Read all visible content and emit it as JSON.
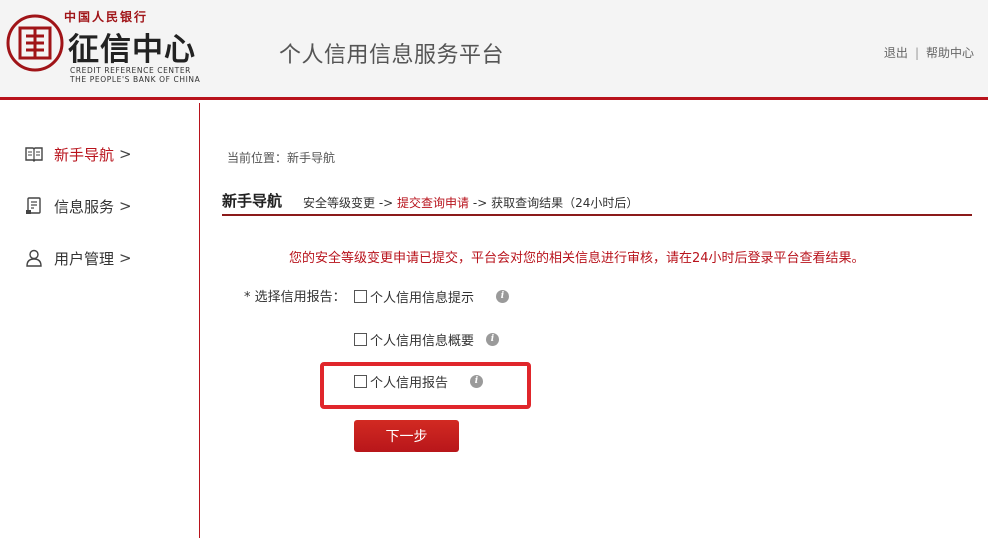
{
  "header": {
    "logo_top": "中国人民银行",
    "logo_name": "征信中心",
    "logo_en_line1": "CREDIT REFERENCE CENTER",
    "logo_en_line2": "THE PEOPLE'S BANK OF CHINA",
    "platform_title": "个人信用信息服务平台",
    "logout": "退出",
    "separator": "|",
    "help": "帮助中心"
  },
  "sidebar": {
    "items": [
      {
        "label": "新手导航",
        "arrow": ">",
        "icon": "book-icon",
        "active": true
      },
      {
        "label": "信息服务",
        "arrow": ">",
        "icon": "document-icon",
        "active": false
      },
      {
        "label": "用户管理",
        "arrow": ">",
        "icon": "user-icon",
        "active": false
      }
    ]
  },
  "breadcrumb": {
    "text": "当前位置：新手导航"
  },
  "section": {
    "title": "新手导航",
    "step1": "安全等级变更",
    "arrow1": " -> ",
    "step2": "提交查询申请",
    "arrow2": " -> ",
    "step3": "获取查询结果（24小时后）"
  },
  "notice": "您的安全等级变更申请已提交，平台会对您的相关信息进行审核，请在24小时后登录平台查看结果。",
  "form": {
    "label": "* 选择信用报告：",
    "options": [
      {
        "label": "个人信用信息提示"
      },
      {
        "label": "个人信用信息概要"
      },
      {
        "label": "个人信用报告"
      }
    ],
    "info_glyph": "i",
    "next_button": "下一步"
  },
  "colors": {
    "accent": "#b8131c",
    "highlight": "#e0262b",
    "header_bg": "#f4f4f4"
  }
}
